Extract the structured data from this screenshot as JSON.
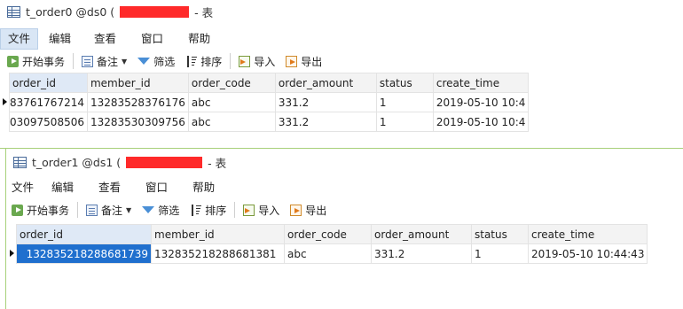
{
  "window1": {
    "title": "t_order0 @ds0 (",
    "title_suffix": "- 表",
    "menu": [
      "文件",
      "编辑",
      "查看",
      "窗口",
      "帮助"
    ],
    "toolbar": {
      "begin_tx": "开始事务",
      "note": "备注",
      "filter": "筛选",
      "sort": "排序",
      "import": "导入",
      "export": "导出"
    },
    "columns": [
      "order_id",
      "member_id",
      "order_code",
      "order_amount",
      "status",
      "create_time"
    ],
    "rows": [
      [
        "83761767214",
        "13283528376176",
        "abc",
        "331.2",
        "1",
        "2019-05-10 10:4"
      ],
      [
        "03097508506",
        "13283530309756",
        "abc",
        "331.2",
        "1",
        "2019-05-10 10:4"
      ]
    ]
  },
  "window2": {
    "title": "t_order1 @ds1 (",
    "title_suffix": "- 表",
    "menu": [
      "文件",
      "编辑",
      "查看",
      "窗口",
      "帮助"
    ],
    "toolbar": {
      "begin_tx": "开始事务",
      "note": "备注",
      "filter": "筛选",
      "sort": "排序",
      "import": "导入",
      "export": "导出"
    },
    "columns": [
      "order_id",
      "member_id",
      "order_code",
      "order_amount",
      "status",
      "create_time"
    ],
    "rows": [
      [
        "132835218288681739",
        "132835218288681381",
        "abc",
        "331.2",
        "1",
        "2019-05-10 10:44:43"
      ]
    ]
  },
  "colors": {
    "redaction": "#ff2a2a",
    "selected_cell": "#1f6fce",
    "active_menu": "#d9e6f5",
    "divider": "#a7d07a"
  }
}
